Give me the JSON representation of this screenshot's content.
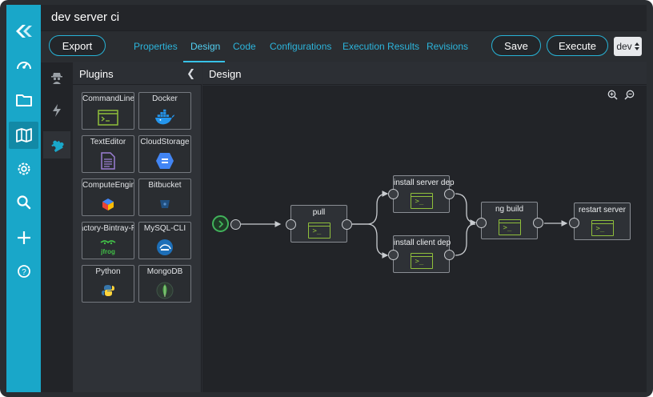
{
  "app": {
    "title": "dev server ci"
  },
  "rail": {
    "icons": [
      "logo-icon",
      "dashboard-gauge-icon",
      "folder-icon",
      "map-icon",
      "settings-gear-icon",
      "search-icon",
      "add-icon",
      "help-icon"
    ],
    "active": "map-icon"
  },
  "toolbar": {
    "export_label": "Export",
    "save_label": "Save",
    "execute_label": "Execute",
    "tabs": [
      {
        "label": "Properties"
      },
      {
        "label": "Design"
      },
      {
        "label": "Code"
      },
      {
        "label": "Configurations"
      },
      {
        "label": "Execution Results"
      },
      {
        "label": "Revisions"
      }
    ],
    "active_tab": "Design",
    "environment": {
      "selected": "dev"
    }
  },
  "subrail": {
    "icons": [
      "agent-icon",
      "lightning-icon",
      "puzzle-icon"
    ],
    "active": "puzzle-icon"
  },
  "plugins": {
    "title": "Plugins",
    "items": [
      {
        "label": "CommandLine",
        "icon": "terminal-icon"
      },
      {
        "label": "Docker",
        "icon": "docker-icon"
      },
      {
        "label": "TextEditor",
        "icon": "document-icon"
      },
      {
        "label": "CloudStorage",
        "icon": "cloud-storage-icon"
      },
      {
        "label": "ComputeEngine",
        "icon": "compute-engine-icon"
      },
      {
        "label": "Bitbucket",
        "icon": "bitbucket-icon"
      },
      {
        "label": "tifactory-Bintray-REST",
        "icon": "jfrog-icon"
      },
      {
        "label": "MySQL-CLI",
        "icon": "mysql-icon"
      },
      {
        "label": "Python",
        "icon": "python-icon"
      },
      {
        "label": "MongoDB",
        "icon": "mongodb-icon"
      }
    ]
  },
  "design": {
    "title": "Design",
    "nodes": [
      {
        "label": "pull"
      },
      {
        "label": "install server dep"
      },
      {
        "label": "install client dep"
      },
      {
        "label": "ng build"
      },
      {
        "label": "restart server"
      }
    ],
    "terminal_glyph": ">_"
  },
  "colors": {
    "accent": "#19a7c9",
    "tab_text": "#2cb5dc",
    "terminal_green": "#8fbf3b",
    "start_green": "#41b35b"
  }
}
